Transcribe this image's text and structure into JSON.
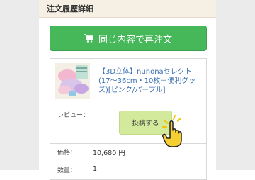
{
  "section": {
    "title": "注文履歴詳細"
  },
  "reorder_button": {
    "label": "同じ内容で再注文",
    "icon": "cart-icon",
    "color": "#47b85a"
  },
  "product": {
    "name": "【3D立体】nunonaセレクト(17〜36cm・10枚＋便利グッズ)[ピンク/パープル]",
    "thumbnail": "product-thumbnail"
  },
  "review": {
    "label": "レビュー：",
    "post_label": "投稿する",
    "button_color": "#d3ea9c"
  },
  "price": {
    "label": "価格：",
    "value": "10,680 円"
  },
  "quantity": {
    "label": "数量：",
    "value": "1"
  },
  "pointer": "hand-pointer-icon"
}
